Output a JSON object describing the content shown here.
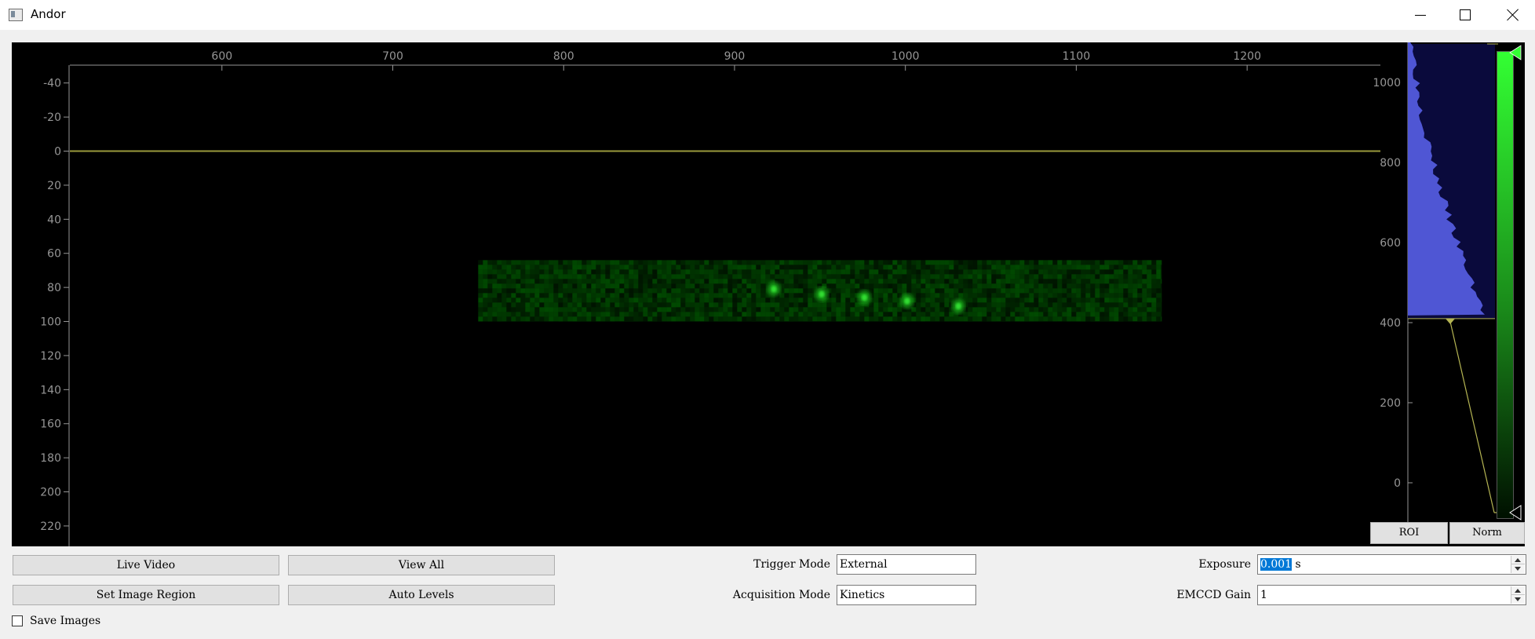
{
  "window": {
    "title": "Andor",
    "icon": "app-window-icon"
  },
  "window_controls": [
    "minimize-icon",
    "maximize-icon",
    "close-icon"
  ],
  "image_view": {
    "x_ticks": [
      600,
      700,
      800,
      900,
      1000,
      1100,
      1200
    ],
    "x_tick_labels": [
      "600",
      "700",
      "800",
      "900",
      "1000",
      "1100",
      "1200"
    ],
    "y_ticks": [
      -40,
      -20,
      0,
      20,
      40,
      60,
      80,
      100,
      120,
      140,
      160,
      180,
      200,
      220
    ],
    "y_tick_labels": [
      "-40",
      "-20",
      "0",
      "20",
      "40",
      "60",
      "80",
      "100",
      "120",
      "140",
      "160",
      "180",
      "200",
      "220"
    ],
    "x_range": [
      511,
      1278
    ],
    "y_range": [
      -50,
      232
    ],
    "roi_line_y": 0,
    "image_extent": {
      "x": [
        750,
        1150
      ],
      "y": [
        64,
        100
      ]
    },
    "spots": [
      {
        "x": 923,
        "y": 81
      },
      {
        "x": 951,
        "y": 84
      },
      {
        "x": 976,
        "y": 86
      },
      {
        "x": 1001,
        "y": 88
      },
      {
        "x": 1031,
        "y": 91
      }
    ],
    "colors": {
      "background": "#000000",
      "axis": "#969696",
      "roi_line": "#9a9a3c",
      "signal": "#32dc32"
    }
  },
  "histogram": {
    "y_ticks": [
      0,
      200,
      400,
      600,
      800,
      1000
    ],
    "y_tick_labels": [
      "0",
      "200",
      "400",
      "600",
      "800",
      "1000"
    ],
    "y_range": [
      -100,
      1100
    ],
    "level_low": 410,
    "level_high": 1100,
    "colors": {
      "fill": "#4f56d4",
      "background": "#0a0a3c",
      "gradient_top": "#33ff33",
      "level_line": "#b5b553"
    },
    "buttons": {
      "roi": "ROI",
      "norm": "Norm"
    }
  },
  "controls": {
    "live_video": "Live Video",
    "view_all": "View All",
    "set_image_region": "Set Image Region",
    "auto_levels": "Auto Levels",
    "save_images": "Save Images",
    "save_images_checked": false,
    "trigger_mode_label": "Trigger Mode",
    "trigger_mode_value": "External",
    "acquisition_mode_label": "Acquisition Mode",
    "acquisition_mode_value": "Kinetics",
    "exposure_label": "Exposure",
    "exposure_value": "0.001",
    "exposure_unit": "s",
    "emccd_gain_label": "EMCCD Gain",
    "emccd_gain_value": "1"
  }
}
